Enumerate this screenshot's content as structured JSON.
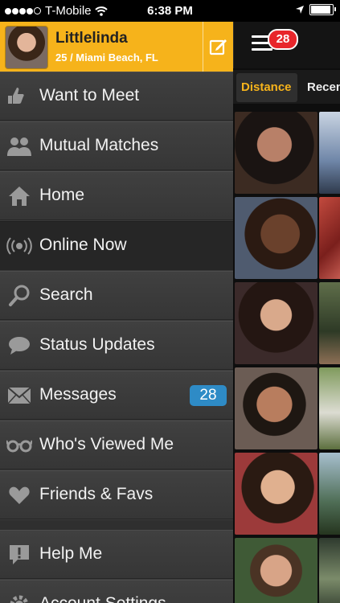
{
  "status_bar": {
    "carrier": "T-Mobile",
    "time": "6:38 PM"
  },
  "profile": {
    "name": "Littlelinda",
    "info": "25 / Miami Beach, FL"
  },
  "menu": {
    "items": [
      {
        "label": "Want to Meet",
        "icon": "thumbs-icon"
      },
      {
        "label": "Mutual Matches",
        "icon": "mutual-matches-icon"
      },
      {
        "label": "Home",
        "icon": "home-icon"
      },
      {
        "label": "Online Now",
        "icon": "online-icon"
      },
      {
        "label": "Search",
        "icon": "search-icon"
      },
      {
        "label": "Status Updates",
        "icon": "speech-bubble-icon"
      },
      {
        "label": "Messages",
        "icon": "envelope-icon",
        "badge": "28"
      },
      {
        "label": "Who's Viewed Me",
        "icon": "glasses-icon"
      },
      {
        "label": "Friends & Favs",
        "icon": "heart-icon"
      },
      {
        "label": "Help Me",
        "icon": "help-icon"
      },
      {
        "label": "Account Settings",
        "icon": "gear-icon"
      }
    ]
  },
  "header": {
    "notification_count": "28"
  },
  "tabs": {
    "active": "Distance",
    "other": "Recent"
  },
  "colors": {
    "accent": "#f6b31b",
    "badge_blue": "#2e8bc6",
    "badge_red": "#e8262b"
  }
}
